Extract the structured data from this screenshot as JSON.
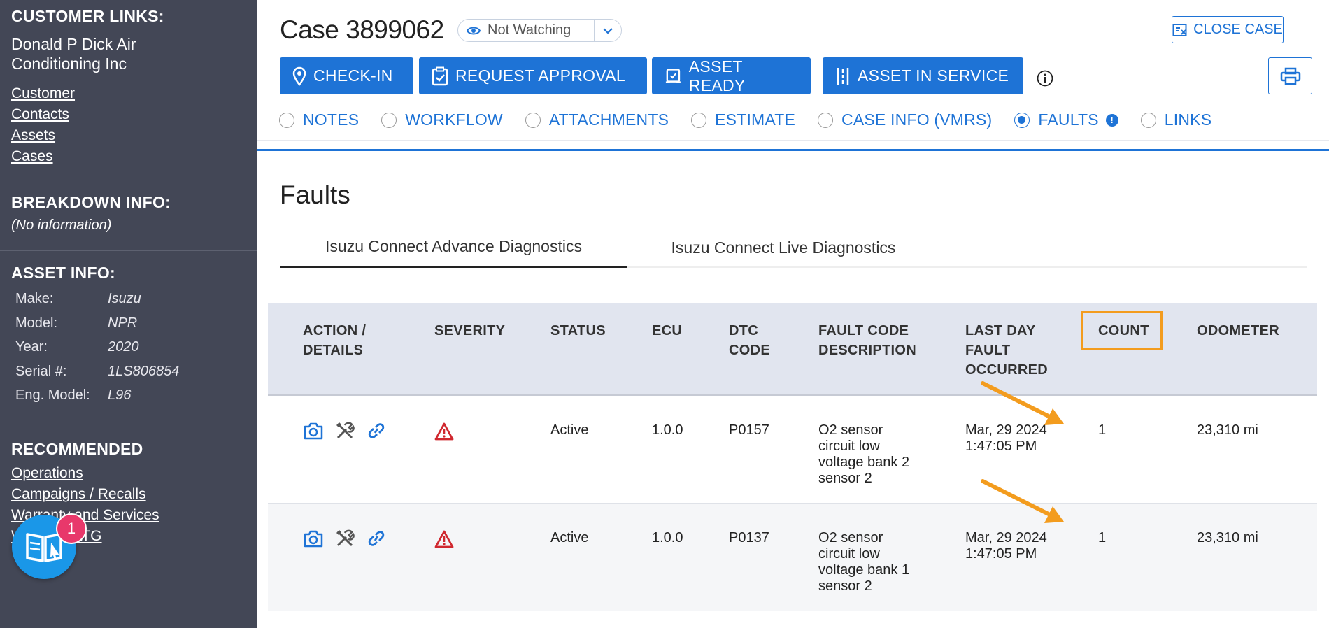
{
  "sidebar": {
    "customer_links_title": "CUSTOMER LINKS:",
    "customer_name": "Donald P Dick Air Conditioning Inc",
    "customer_links": [
      "Customer",
      "Contacts",
      "Assets",
      "Cases"
    ],
    "breakdown_title": "BREAKDOWN INFO:",
    "breakdown_value": "(No information)",
    "asset_title": "ASSET INFO:",
    "asset": [
      {
        "key": "Make:",
        "value": "Isuzu"
      },
      {
        "key": "Model:",
        "value": "NPR"
      },
      {
        "key": "Year:",
        "value": "2020"
      },
      {
        "key": "Serial #:",
        "value": "1LS806854"
      },
      {
        "key": "Eng. Model:",
        "value": "L96"
      }
    ],
    "recommended_title": "RECOMMENDED",
    "recommended_links": [
      "Operations",
      "Campaigns / Recalls",
      "Warranty and Services",
      "Warranty LTG"
    ],
    "fab_badge": "1"
  },
  "header": {
    "case_title": "Case 3899062",
    "watch_label": "Not Watching",
    "close_case": "CLOSE CASE"
  },
  "actions": {
    "checkin": "CHECK-IN",
    "request_approval": "REQUEST APPROVAL",
    "asset_ready": "ASSET READY",
    "asset_in_service": "ASSET IN SERVICE"
  },
  "tabs": [
    {
      "label": "NOTES",
      "selected": false
    },
    {
      "label": "WORKFLOW",
      "selected": false
    },
    {
      "label": "ATTACHMENTS",
      "selected": false
    },
    {
      "label": "ESTIMATE",
      "selected": false
    },
    {
      "label": "CASE INFO (VMRS)",
      "selected": false
    },
    {
      "label": "FAULTS",
      "selected": true
    },
    {
      "label": "LINKS",
      "selected": false
    }
  ],
  "faults": {
    "title": "Faults",
    "subtabs": [
      "Isuzu Connect Advance Diagnostics",
      "Isuzu Connect Live Diagnostics"
    ],
    "columns": {
      "action": "ACTION / DETAILS",
      "severity": "SEVERITY",
      "status": "STATUS",
      "ecu": "ECU",
      "dtc": "DTC CODE",
      "description": "FAULT CODE DESCRIPTION",
      "last_day": "LAST DAY FAULT OCCURRED",
      "count": "COUNT",
      "odometer": "ODOMETER"
    },
    "rows": [
      {
        "status": "Active",
        "ecu": "1.0.0",
        "dtc": "P0157",
        "description": "O2 sensor circuit low voltage bank 2 sensor 2",
        "last_day": "Mar, 29 2024 1:47:05 PM",
        "count": "1",
        "odometer": "23,310 mi"
      },
      {
        "status": "Active",
        "ecu": "1.0.0",
        "dtc": "P0137",
        "description": "O2 sensor circuit low voltage bank 1 sensor 2",
        "last_day": "Mar, 29 2024 1:47:05 PM",
        "count": "1",
        "odometer": "23,310 mi"
      }
    ]
  },
  "colors": {
    "sidebar_bg": "#434756",
    "accent": "#1e73d6",
    "highlight": "#f39c1e",
    "severity": "#d0282f",
    "badge": "#e8386b"
  }
}
